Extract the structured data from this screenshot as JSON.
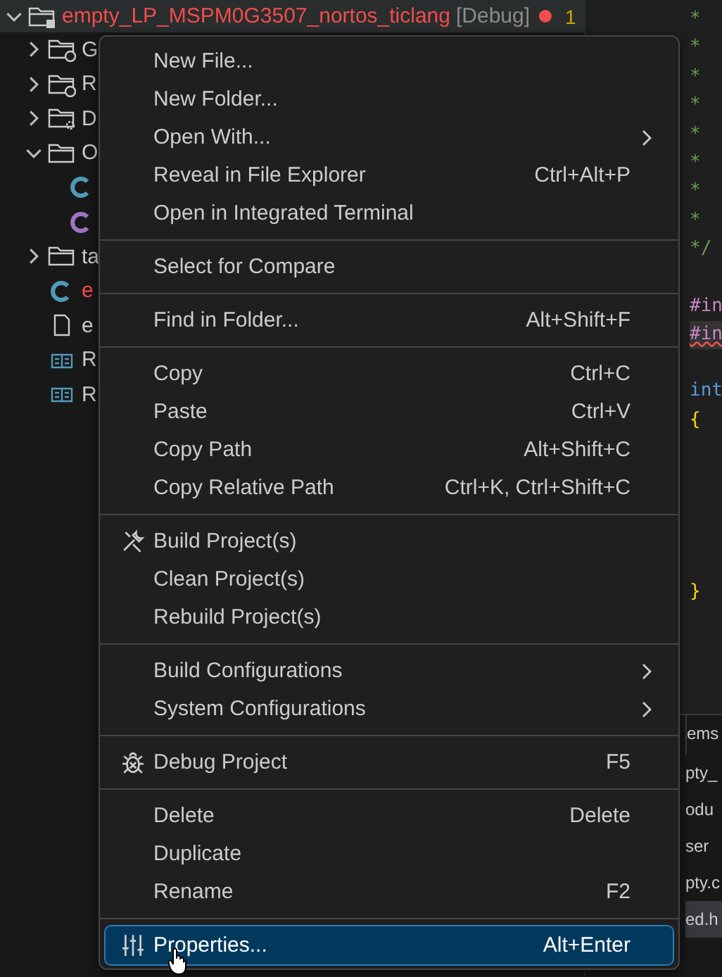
{
  "explorer": {
    "project": {
      "name": "empty_LP_MSPM0G3507_nortos_ticlang",
      "config": "[Debug]",
      "problems": "1",
      "expanded": true,
      "children": [
        {
          "kind": "linked-folder",
          "label": "G",
          "expanded": false
        },
        {
          "kind": "linked-folder",
          "label": "R",
          "expanded": false
        },
        {
          "kind": "gear-folder",
          "label": "D",
          "expanded": false
        },
        {
          "kind": "folder",
          "label": "O",
          "expanded": true,
          "children": [
            {
              "kind": "c-source"
            },
            {
              "kind": "c-header"
            }
          ]
        },
        {
          "kind": "folder",
          "label": "ta",
          "expanded": false
        },
        {
          "kind": "c-source",
          "label": "e",
          "error": true
        },
        {
          "kind": "file",
          "label": "e"
        },
        {
          "kind": "readme",
          "label": "R"
        },
        {
          "kind": "readme",
          "label": "R"
        }
      ]
    }
  },
  "editor": {
    "blocks": [
      [
        {
          "kind": "comment",
          "text": "*",
          "error": false
        },
        {
          "kind": "comment",
          "text": "*",
          "error": false
        },
        {
          "kind": "comment",
          "text": "*",
          "error": false
        },
        {
          "kind": "comment",
          "text": "*",
          "error": false
        },
        {
          "kind": "comment",
          "text": "*",
          "error": false
        },
        {
          "kind": "comment",
          "text": "*",
          "error": false
        },
        {
          "kind": "comment",
          "text": "*",
          "error": false
        },
        {
          "kind": "comment",
          "text": "*",
          "error": false
        },
        {
          "kind": "comment",
          "text": "*/",
          "error": false
        }
      ],
      [
        {
          "kind": "directive",
          "text": "#in",
          "error": false
        },
        {
          "kind": "directive",
          "text": "#in",
          "error": true
        }
      ],
      [
        {
          "kind": "keyword",
          "text": "int",
          "error": false
        },
        {
          "kind": "brace",
          "text": "{",
          "error": false
        }
      ],
      [
        {
          "kind": "brace",
          "text": "}",
          "error": false
        }
      ]
    ]
  },
  "panel": {
    "tab": "ems",
    "rows": [
      {
        "text": "pty_",
        "selected": false
      },
      {
        "text": "odu",
        "selected": false
      },
      {
        "text": "ser",
        "selected": false
      },
      {
        "text": "pty.c",
        "selected": false
      },
      {
        "text": "ed.h",
        "selected": true
      }
    ]
  },
  "context_menu": {
    "groups": [
      [
        {
          "label": "New File...",
          "selected": false
        },
        {
          "label": "New Folder...",
          "selected": false
        },
        {
          "label": "Open With...",
          "submenu": true,
          "selected": false
        },
        {
          "label": "Reveal in File Explorer",
          "shortcut": "Ctrl+Alt+P",
          "selected": false
        },
        {
          "label": "Open in Integrated Terminal",
          "selected": false
        }
      ],
      [
        {
          "label": "Select for Compare",
          "selected": false
        }
      ],
      [
        {
          "label": "Find in Folder...",
          "shortcut": "Alt+Shift+F",
          "selected": false
        }
      ],
      [
        {
          "label": "Copy",
          "shortcut": "Ctrl+C",
          "selected": false
        },
        {
          "label": "Paste",
          "shortcut": "Ctrl+V",
          "selected": false
        },
        {
          "label": "Copy Path",
          "shortcut": "Alt+Shift+C",
          "selected": false
        },
        {
          "label": "Copy Relative Path",
          "shortcut": "Ctrl+K, Ctrl+Shift+C",
          "selected": false
        }
      ],
      [
        {
          "label": "Build Project(s)",
          "kind": "tools",
          "selected": false
        },
        {
          "label": "Clean Project(s)",
          "selected": false
        },
        {
          "label": "Rebuild Project(s)",
          "selected": false
        }
      ],
      [
        {
          "label": "Build Configurations",
          "submenu": true,
          "selected": false
        },
        {
          "label": "System Configurations",
          "submenu": true,
          "selected": false
        }
      ],
      [
        {
          "label": "Debug Project",
          "kind": "bug",
          "shortcut": "F5",
          "selected": false
        }
      ],
      [
        {
          "label": "Delete",
          "shortcut": "Delete",
          "selected": false
        },
        {
          "label": "Duplicate",
          "selected": false
        },
        {
          "label": "Rename",
          "shortcut": "F2",
          "selected": false
        }
      ],
      [
        {
          "label": "Properties...",
          "kind": "sliders",
          "shortcut": "Alt+Enter",
          "selected": true,
          "pointer": true
        }
      ]
    ]
  }
}
